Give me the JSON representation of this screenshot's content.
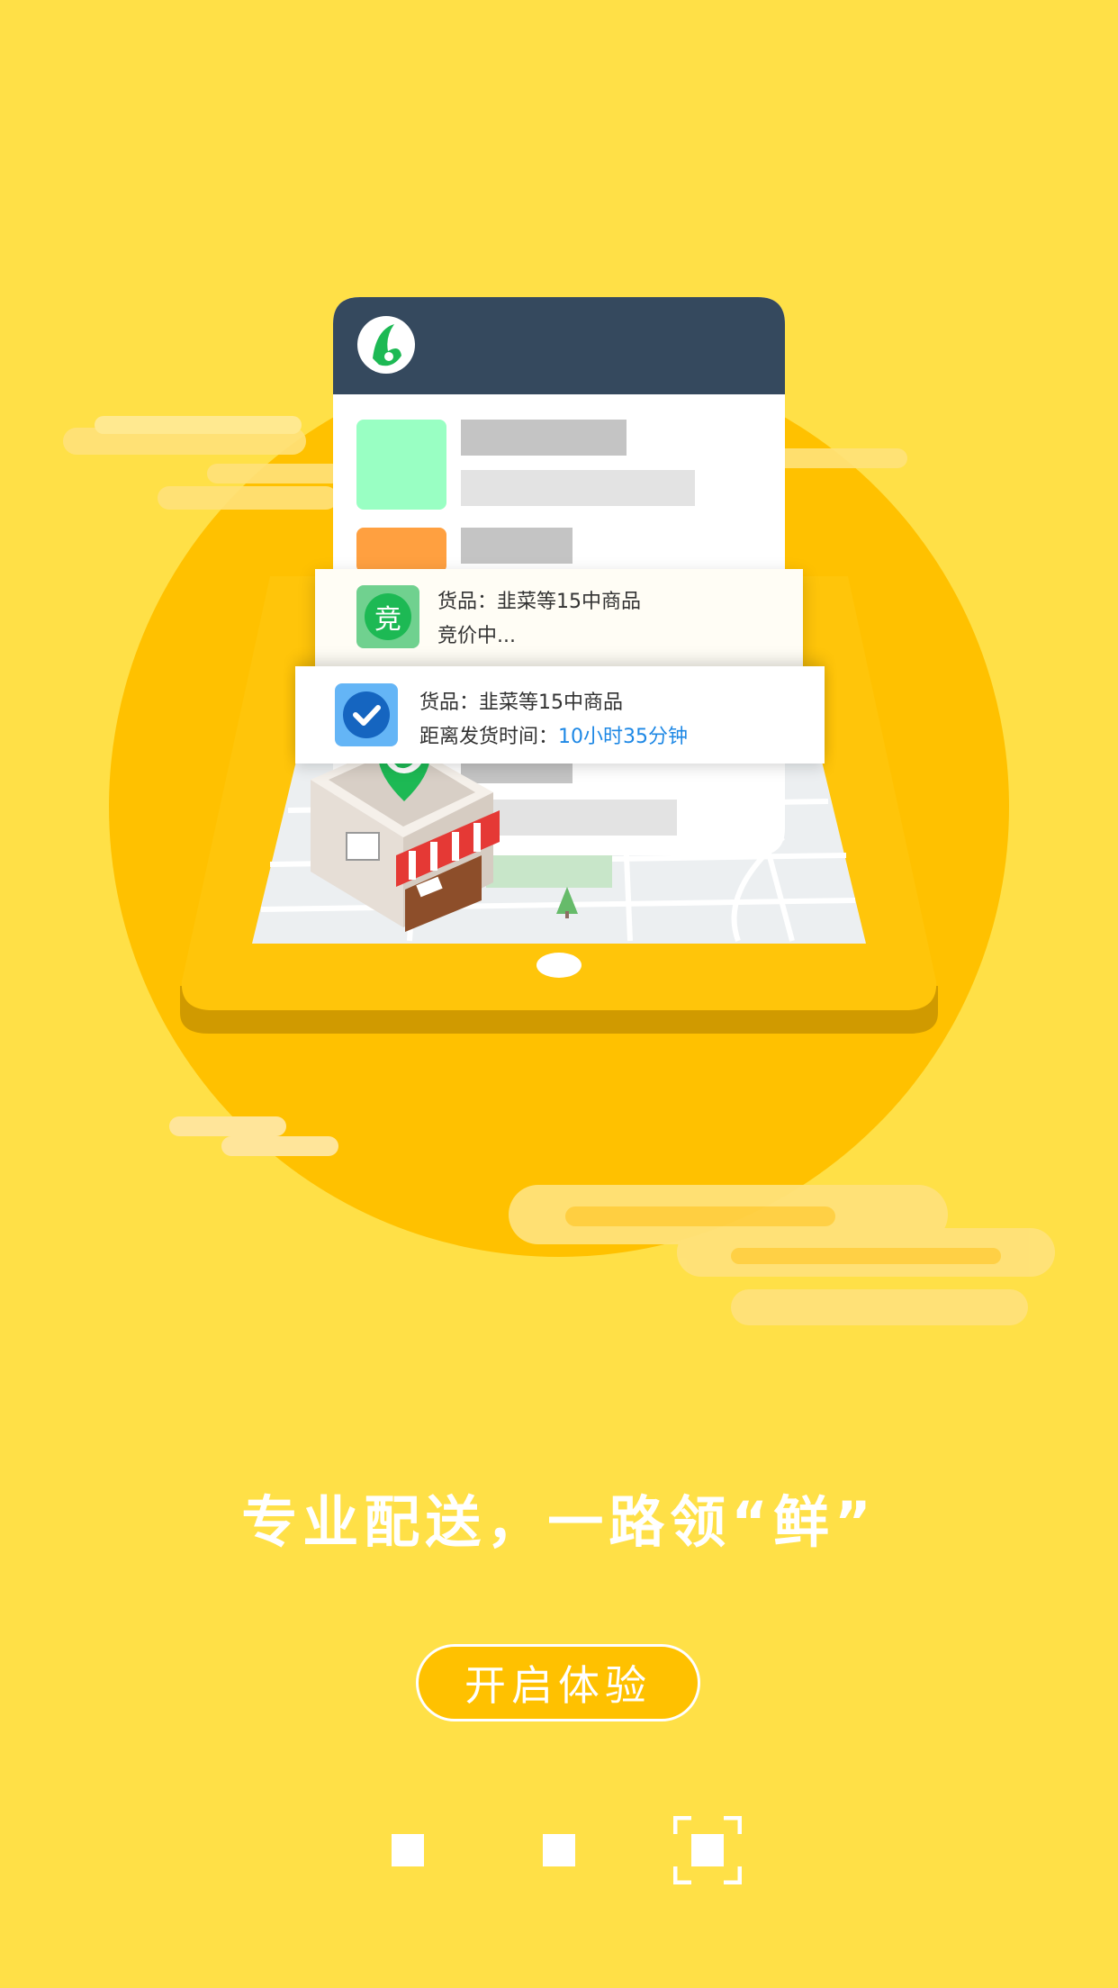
{
  "cards": {
    "bidding": {
      "icon_char": "竞",
      "goods": "货品：韭菜等15中商品",
      "status": "竞价中..."
    },
    "confirmed": {
      "goods": "货品：韭菜等15中商品",
      "distance_label": "距离发货时间：",
      "distance_value": "10小时35分钟"
    }
  },
  "slogan": "专业配送，一路领“鲜”",
  "start_button": "开启体验",
  "pager": {
    "total": 3,
    "active": 3
  },
  "colors": {
    "background": "#FFE047",
    "circle": "#FFC100",
    "header": "#34495E",
    "accent_green": "#1DB954",
    "highlight_blue": "#1E88E5"
  }
}
